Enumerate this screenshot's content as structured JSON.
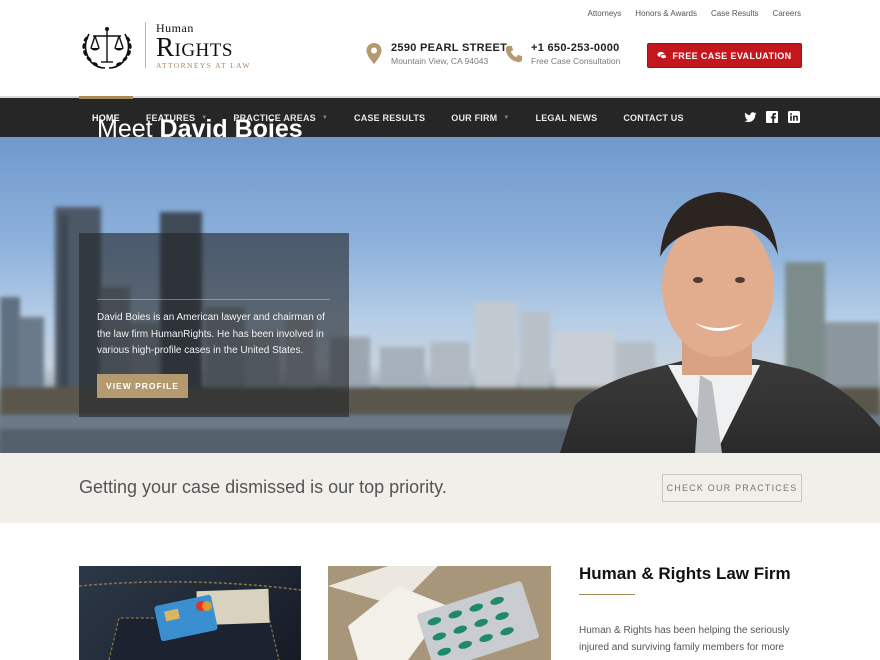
{
  "top_links": [
    "Attorneys",
    "Honors & Awards",
    "Case Results",
    "Careers"
  ],
  "logo": {
    "top": "Human",
    "main": "Rights",
    "sub": "ATTORNEYS AT LAW"
  },
  "address": {
    "main": "2590 PEARL STREET",
    "sub": "Mountain View, CA 94043"
  },
  "phone": {
    "main": "+1 650-253-0000",
    "sub": "Free Case Consultation"
  },
  "cta": {
    "label": "FREE CASE EVALUATION",
    "icon": "chat-bubbles-icon"
  },
  "nav": {
    "items": [
      {
        "label": "HOME",
        "dropdown": false,
        "active": true
      },
      {
        "label": "FEATURES",
        "dropdown": true,
        "active": false
      },
      {
        "label": "PRACTICE AREAS",
        "dropdown": true,
        "active": false
      },
      {
        "label": "CASE RESULTS",
        "dropdown": false,
        "active": false
      },
      {
        "label": "OUR FIRM",
        "dropdown": true,
        "active": false
      },
      {
        "label": "LEGAL NEWS",
        "dropdown": false,
        "active": false
      },
      {
        "label": "CONTACT US",
        "dropdown": false,
        "active": false
      }
    ],
    "social": [
      "twitter-icon",
      "facebook-icon",
      "linkedin-icon"
    ]
  },
  "hero": {
    "title_light": "Meet",
    "title_bold": "David Boies",
    "text": "David Boies is an American lawyer and chairman of the law firm HumanRights. He has been involved in various high-profile cases in the United States.",
    "button": "VIEW PROFILE"
  },
  "band": {
    "text": "Getting your case dismissed is our top priority.",
    "button": "CHECK OUR PRACTICES"
  },
  "firm": {
    "title": "Human & Rights Law Firm",
    "text": "Human & Rights has been helping the seriously injured and surviving family members for more"
  },
  "colors": {
    "accent_gold": "#a9895a",
    "cta_red": "#c3171d",
    "nav_bg": "#262626",
    "band_bg": "#f1efea"
  }
}
